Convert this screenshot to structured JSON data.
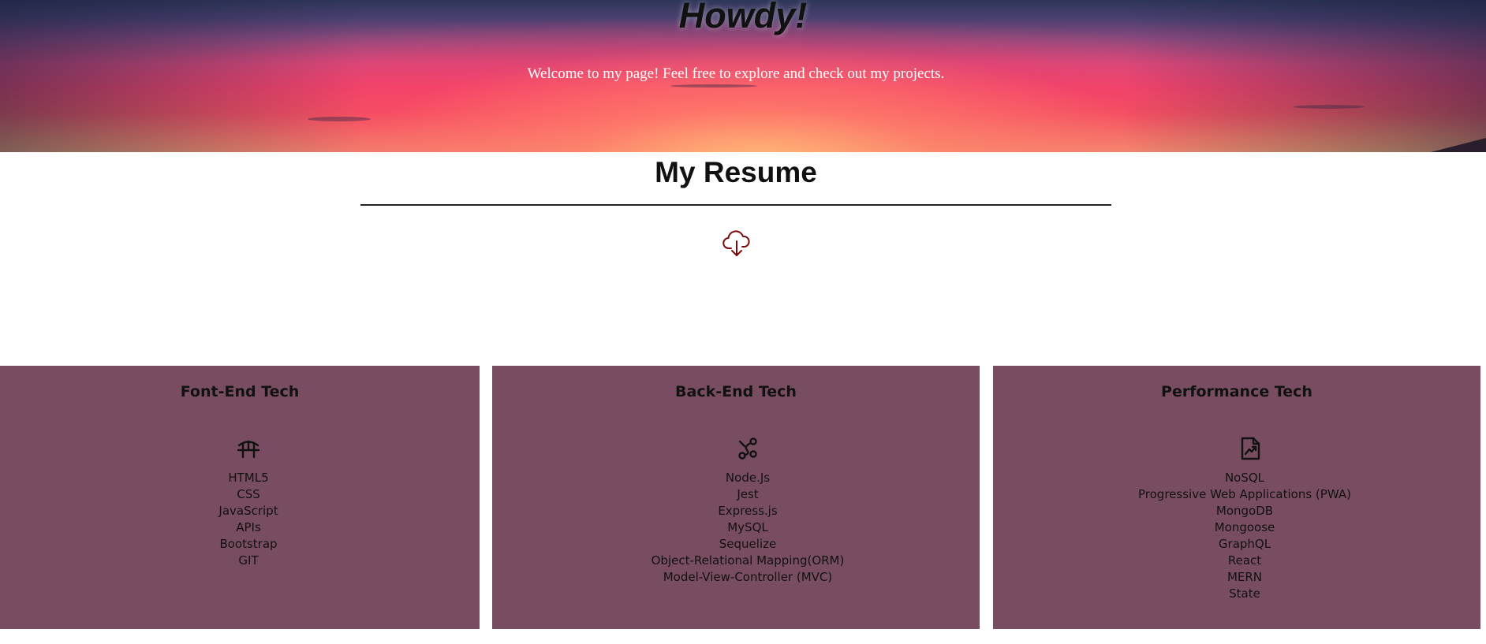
{
  "hero": {
    "title": "Howdy!",
    "subtitle": "Welcome to my page! Feel free to explore and check out my projects."
  },
  "resume": {
    "title": "My Resume",
    "download_icon": "cloud-download-icon",
    "accent_color": "#7a0a0a"
  },
  "cards": [
    {
      "title": "Font-End Tech",
      "icon": "bridge-icon",
      "items": [
        "HTML5",
        "CSS",
        "JavaScript",
        "APIs",
        "Bootstrap",
        "GIT"
      ]
    },
    {
      "title": "Back-End Tech",
      "icon": "bezier-curve-icon",
      "items": [
        "Node.Js",
        "Jest",
        "Express.js",
        "MySQL",
        "Sequelize",
        "Object-Relational Mapping(ORM)",
        "Model-View-Controller (MVC)"
      ]
    },
    {
      "title": "Performance Tech",
      "icon": "file-chart-icon",
      "items": [
        "NoSQL",
        "Progressive Web Applications (PWA)",
        "MongoDB",
        "Mongoose",
        "GraphQL",
        "React",
        "MERN",
        "State"
      ]
    }
  ],
  "colors": {
    "card_background": "#784d61",
    "hero_sunset_pink": "#f3476e",
    "hero_sky_dark": "#2d3658"
  }
}
